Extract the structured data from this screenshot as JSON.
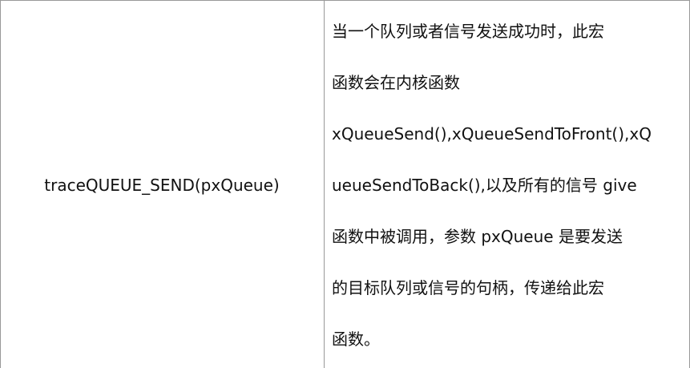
{
  "table": {
    "rows": [
      {
        "macro": "traceQUEUE_SEND(pxQueue)",
        "description_lines": [
          "当一个队列或者信号发送成功时，此宏",
          "函数会在内核函数",
          "xQueueSend(),xQueueSendToFront(),xQ",
          "ueueSendToBack(),以及所有的信号 give",
          "函数中被调用，参数 pxQueue 是要发送",
          "的目标队列或信号的句柄，传递给此宏",
          "函数。"
        ]
      }
    ]
  },
  "colors": {
    "border": "#999999",
    "text": "#111111",
    "background": "#ffffff"
  }
}
